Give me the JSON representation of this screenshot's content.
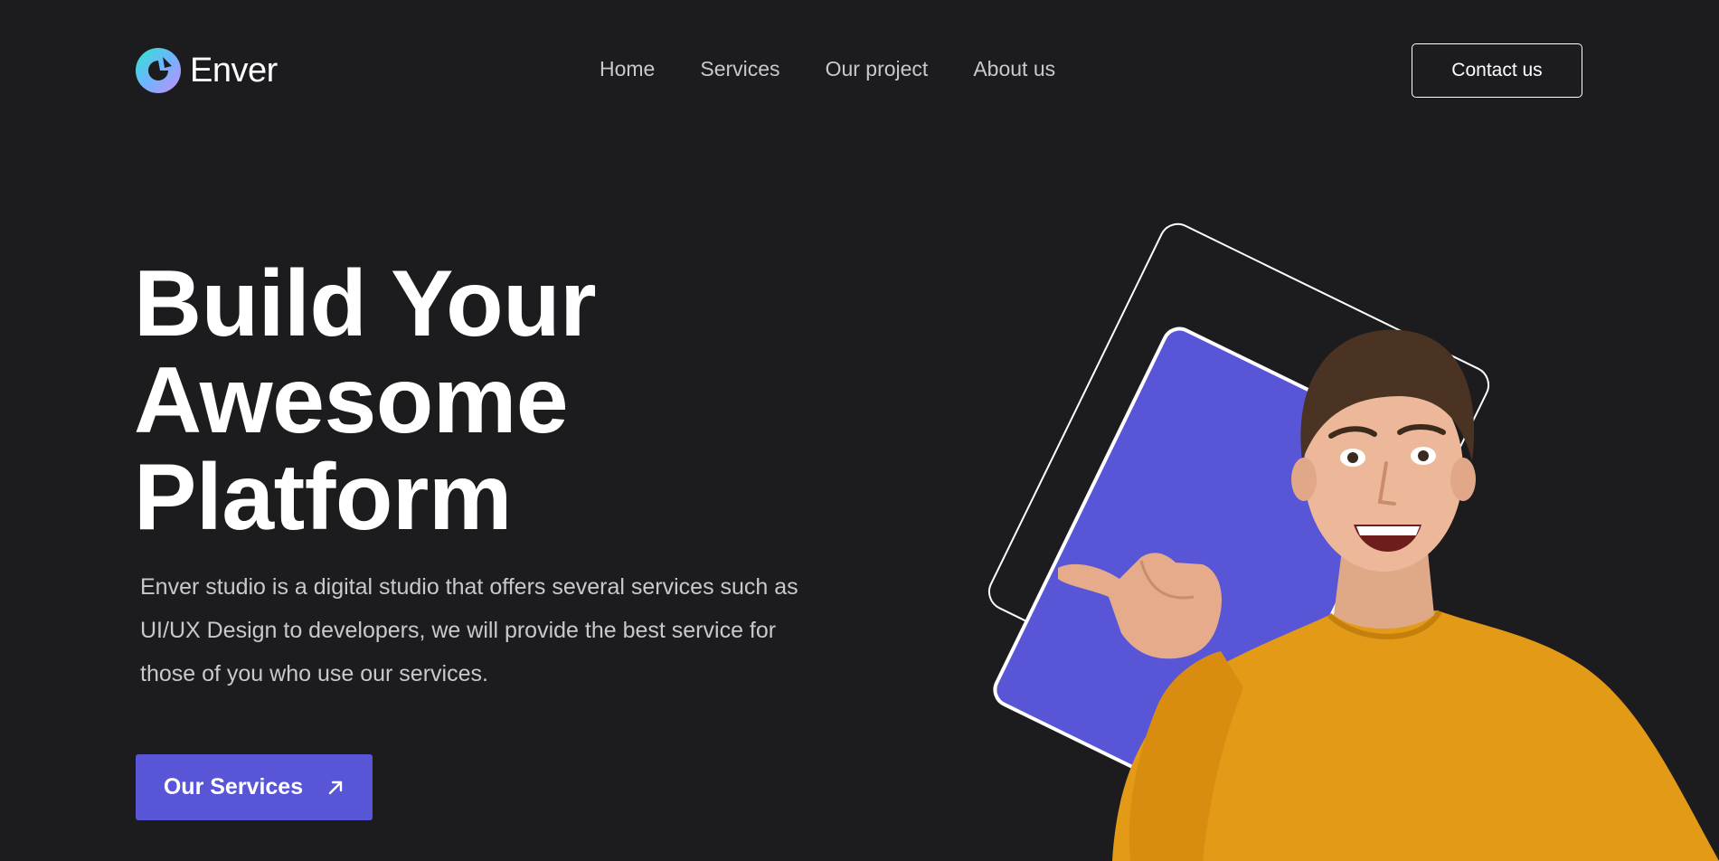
{
  "brand": {
    "name": "Enver",
    "logo_icon": "enver-logo-icon",
    "gradient_colors": [
      "#2ee6c9",
      "#6fb4ff",
      "#c88cf7"
    ]
  },
  "nav": {
    "items": [
      {
        "label": "Home"
      },
      {
        "label": "Services"
      },
      {
        "label": "Our project"
      },
      {
        "label": "About us"
      }
    ]
  },
  "header": {
    "contact_label": "Contact us"
  },
  "hero": {
    "title_lines": [
      "Build Your",
      "Awesome",
      "Platform"
    ],
    "description": "Enver studio is a digital studio that offers several services such as UI/UX Design to developers, we will provide the best service for those of you who use our services.",
    "cta_label": "Our Services",
    "cta_icon": "arrow-up-right-icon"
  },
  "illustration": {
    "subject": "person-pointing-thumb",
    "accent_color": "#5856d6",
    "sweater_color": "#e39a16"
  },
  "colors": {
    "background": "#1c1c1f",
    "accent": "#5856d6",
    "text_primary": "#ffffff",
    "text_secondary": "#c9c9cc"
  }
}
